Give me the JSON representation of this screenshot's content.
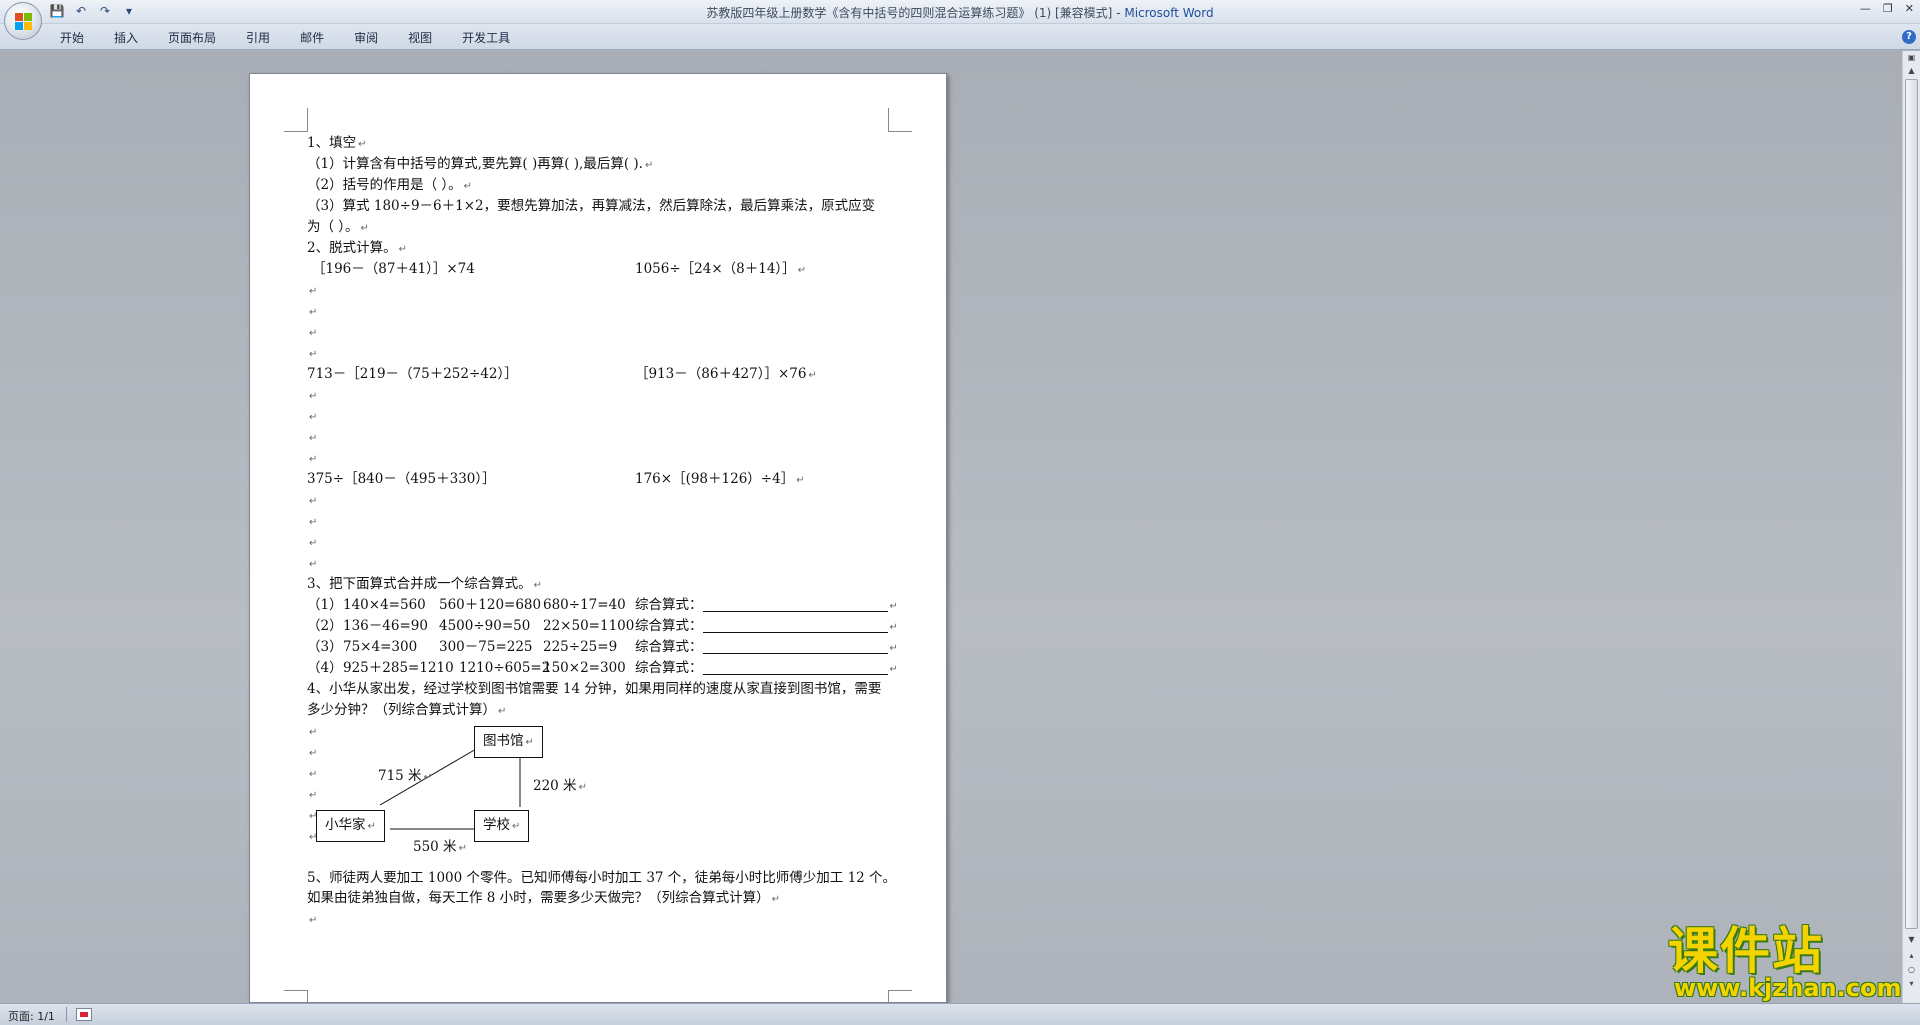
{
  "window": {
    "title_doc": "苏教版四年级上册数学《含有中括号的四则混合运算练习题》 (1) [兼容模式]",
    "title_sep": " - ",
    "title_app": "Microsoft Word"
  },
  "quick_access": {
    "save": "💾",
    "undo": "↶",
    "redo": "↷",
    "more": "▾"
  },
  "ribbon": {
    "tabs": [
      "开始",
      "插入",
      "页面布局",
      "引用",
      "邮件",
      "审阅",
      "视图",
      "开发工具"
    ],
    "help": "?"
  },
  "document": {
    "q1": {
      "title": "1、填空",
      "l1": "（1）计算含有中括号的算式,要先算(              )再算(              ),最后算(              ).",
      "l2": "（2）括号的作用是（                    ）。",
      "l3": "（3）算式 180÷9－6＋1×2，要想先算加法，再算减法，然后算除法，最后算乘法，原式应变",
      "l4": "为（                        ）。"
    },
    "q2": {
      "title": "2、脱式计算。",
      "r1a": "［196－（87＋41）］×74",
      "r1b": "1056÷［24×（8＋14）］",
      "r2a": "713－［219－（75＋252÷42）］",
      "r2b": "［913－（86＋427）］×76",
      "r3a": "375÷［840－（495＋330）］",
      "r3b": "176×［(98＋126）÷4］"
    },
    "q3": {
      "title": "3、把下面算式合并成一个综合算式。",
      "label": "综合算式：",
      "rows": [
        {
          "no": "（1）",
          "a": "140×4=560",
          "b": "560＋120=680",
          "c": "680÷17=40"
        },
        {
          "no": "（2）",
          "a": "136－46=90",
          "b": "4500÷90=50",
          "c": "22×50=1100"
        },
        {
          "no": "（3）",
          "a": "75×4=300",
          "b": "300－75=225",
          "c": "225÷25=9"
        },
        {
          "no": "（4）",
          "a": "925＋285=1210",
          "b": "1210÷605=2",
          "c": "150×2=300"
        }
      ]
    },
    "q4": {
      "l1": "4、小华从家出发，经过学校到图书馆需要 14 分钟，如果用同样的速度从家直接到图书馆，需要",
      "l2": "多少分钟？（列综合算式计算）",
      "diagram": {
        "library": "图书馆",
        "home": "小华家",
        "school": "学校",
        "d_home_library": "715 米",
        "d_school_library": "220 米",
        "d_home_school": "550 米"
      }
    },
    "q5": {
      "l1": "5、师徒两人要加工 1000 个零件。已知师傅每小时加工 37 个，徒弟每小时比师傅少加工 12 个。",
      "l2": "如果由徒弟独自做，每天工作 8 小时，需要多少天做完？（列综合算式计算）"
    },
    "para_mark": "↵"
  },
  "status": {
    "page": "页面: 1/1"
  },
  "watermark": {
    "text": "课件站",
    "url": "www.kjzhan.com"
  },
  "colors": {
    "app_title": "#1f4e9a",
    "watermark_fill": "#f3d400",
    "watermark_outline": "#3a7a12"
  }
}
